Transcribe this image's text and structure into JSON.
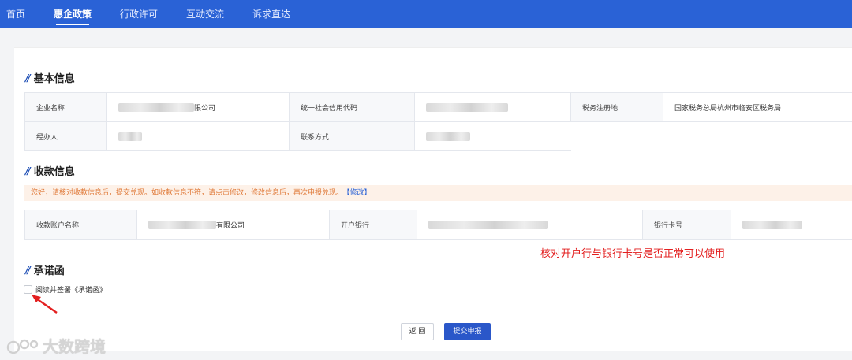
{
  "nav": {
    "items": [
      {
        "label": "首页",
        "active": false
      },
      {
        "label": "惠企政策",
        "active": true
      },
      {
        "label": "行政许可",
        "active": false
      },
      {
        "label": "互动交流",
        "active": false
      },
      {
        "label": "诉求直达",
        "active": false
      }
    ]
  },
  "basic_info": {
    "title": "基本信息",
    "company_name_label": "企业名称",
    "company_name_suffix": "限公司",
    "credit_code_label": "统一社会信用代码",
    "tax_registration_label": "税务注册地",
    "tax_registration_value": "国家税务总局杭州市临安区税务局",
    "handler_label": "经办人",
    "contact_label": "联系方式"
  },
  "payment_info": {
    "title": "收款信息",
    "notice_text": "您好，请核对收款信息后，提交兑现。如收款信息不符，请点击修改，修改信息后，再次申报兑现。",
    "modify_link": "【修改】",
    "account_name_label": "收款账户名称",
    "account_name_suffix": "有限公司",
    "bank_label": "开户银行",
    "card_label": "银行卡号"
  },
  "annotation": "核对开户行与银行卡号是否正常可以使用",
  "commitment": {
    "title": "承诺函",
    "checkbox_label": "阅读并签署《承诺函》",
    "checked": false
  },
  "buttons": {
    "back": "返 回",
    "submit": "提交申报"
  },
  "watermark": "大数跨境",
  "colors": {
    "nav_bg": "#2a62d6",
    "primary": "#2a57c9",
    "notice_bg": "#fdf1e8",
    "notice_text": "#e07a3a",
    "annotation": "#e32020"
  }
}
